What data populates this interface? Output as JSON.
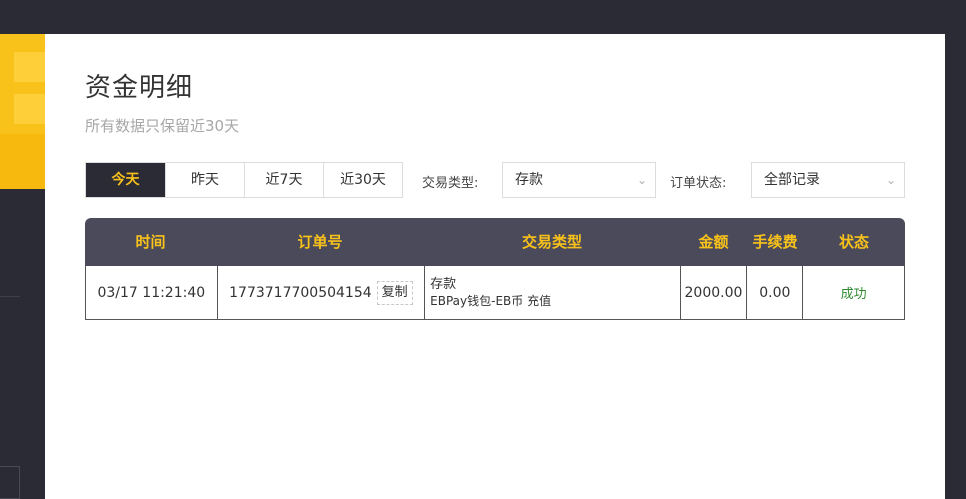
{
  "page": {
    "title": "资金明细",
    "subtitle": "所有数据只保留近30天"
  },
  "tabs": [
    {
      "label": "今天",
      "active": true
    },
    {
      "label": "昨天",
      "active": false
    },
    {
      "label": "近7天",
      "active": false
    },
    {
      "label": "近30天",
      "active": false
    }
  ],
  "filters": {
    "type_label": "交易类型:",
    "type_value": "存款",
    "status_label": "订单状态:",
    "status_value": "全部记录"
  },
  "table": {
    "headers": [
      "时间",
      "订单号",
      "交易类型",
      "金额",
      "手续费",
      "状态"
    ],
    "rows": [
      {
        "time": "03/17 11:21:40",
        "order_no": "1773717700504154",
        "copy_label": "复制",
        "type_main": "存款",
        "type_sub": "EBPay钱包-EB币 充值",
        "amount": "2000.00",
        "fee": "0.00",
        "status": "成功"
      }
    ]
  },
  "colors": {
    "accent": "#f9c21a",
    "dark": "#2b2b35",
    "header_bg": "#4a4a5a",
    "success": "#2f8a2f"
  }
}
